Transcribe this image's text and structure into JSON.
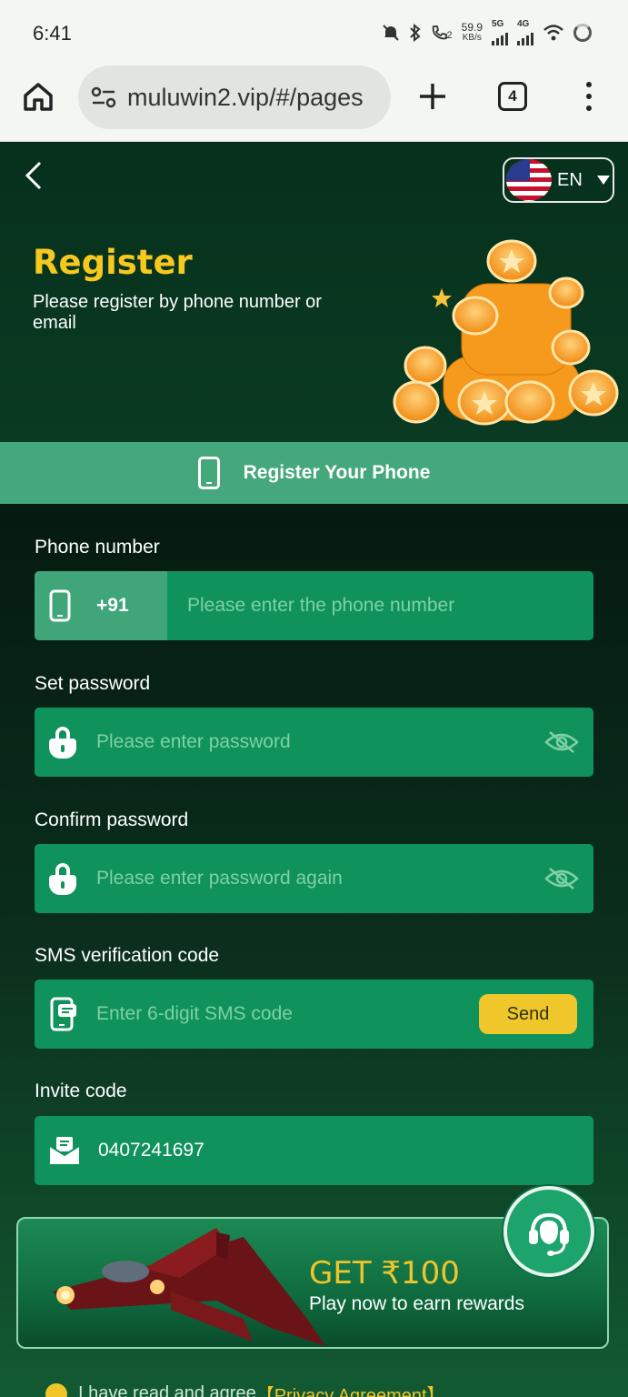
{
  "status_bar": {
    "time": "6:41",
    "speed_value": "59.9",
    "speed_unit": "KB/s",
    "net1": "5G",
    "net2": "4G",
    "call_sim": "2"
  },
  "browser": {
    "url": "muluwin2.vip/#/pages",
    "tab_count": "4"
  },
  "header": {
    "language": "EN",
    "title": "Register",
    "subtitle": "Please register by phone number or email"
  },
  "tab": {
    "label": "Register Your Phone"
  },
  "form": {
    "phone_label": "Phone number",
    "country_code": "+91",
    "phone_placeholder": "Please enter the phone number",
    "password_label": "Set password",
    "password_placeholder": "Please enter password",
    "confirm_label": "Confirm password",
    "confirm_placeholder": "Please enter password again",
    "sms_label": "SMS verification code",
    "sms_placeholder": "Enter 6-digit SMS code",
    "send_label": "Send",
    "invite_label": "Invite code",
    "invite_value": "0407241697"
  },
  "promo": {
    "title": "GET ₹100",
    "subtitle": "Play now to earn rewards"
  },
  "agreement": {
    "text": "I have read and agree ",
    "link": "【Privacy Agreement】"
  },
  "colors": {
    "accent_yellow": "#f7c81e",
    "field_green": "#0f925c",
    "tab_green": "#45a77c",
    "hero_bg": "#06311c"
  },
  "icons": [
    "home-icon",
    "site-settings-icon",
    "plus-icon",
    "tabs-icon",
    "menu-icon",
    "back-icon",
    "us-flag-icon",
    "phone-icon",
    "lock-icon",
    "eye-off-icon",
    "sms-phone-icon",
    "envelope-icon",
    "headset-support-icon",
    "check-icon"
  ]
}
